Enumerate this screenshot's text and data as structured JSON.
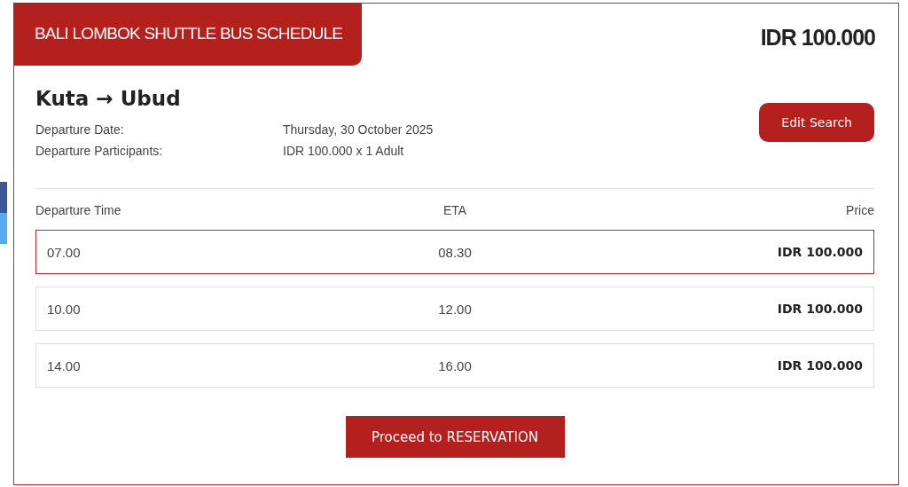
{
  "header": {
    "title": "BALI LOMBOK SHUTTLE BUS SCHEDULE",
    "price": "IDR 100.000"
  },
  "route": {
    "from": "Kuta",
    "arrow": "→",
    "to": "Ubud"
  },
  "details": [
    {
      "label": "Departure Date:",
      "value": "Thursday, 30 October 2025"
    },
    {
      "label": "Departure Participants:",
      "value": "IDR 100.000 x 1 Adult"
    }
  ],
  "edit_button": "Edit Search",
  "table": {
    "columns": [
      "Departure Time",
      "ETA",
      "Price"
    ],
    "rows": [
      {
        "departure": "07.00",
        "eta": "08.30",
        "price": "IDR 100.000",
        "selected": true
      },
      {
        "departure": "10.00",
        "eta": "12.00",
        "price": "IDR 100.000",
        "selected": false
      },
      {
        "departure": "14.00",
        "eta": "16.00",
        "price": "IDR 100.000",
        "selected": false
      }
    ]
  },
  "proceed_button": "Proceed to RESERVATION"
}
